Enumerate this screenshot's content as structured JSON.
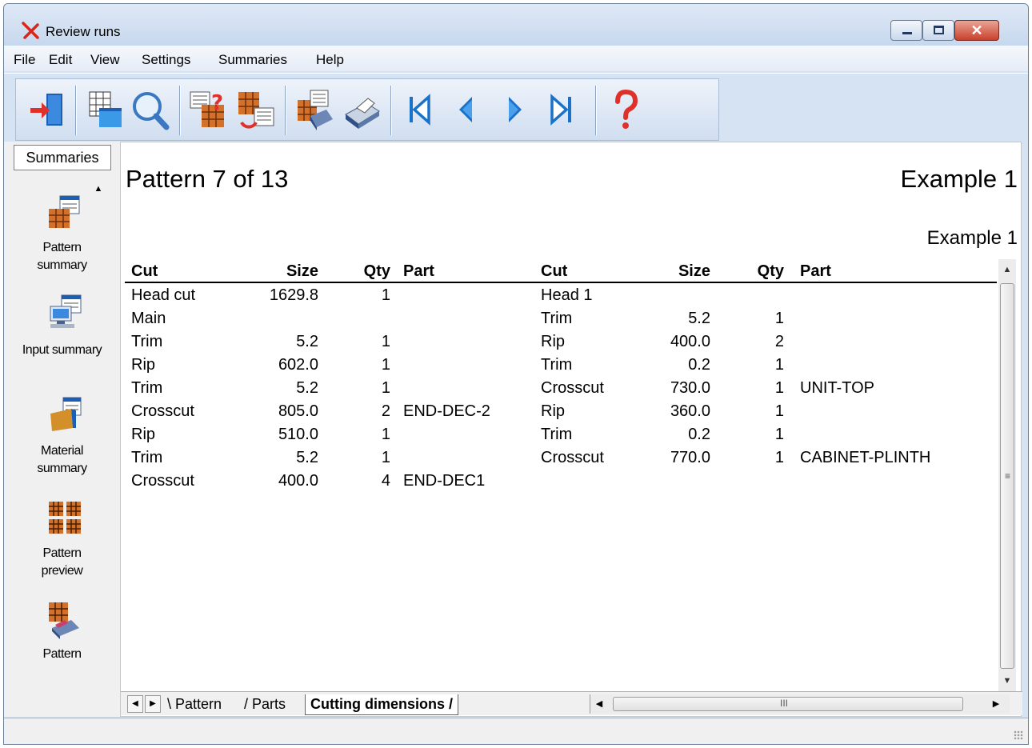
{
  "window": {
    "title": "Review runs"
  },
  "menu": [
    "File",
    "Edit",
    "View",
    "Settings",
    "Summaries",
    "Help"
  ],
  "toolbar": {
    "icons": [
      "exit-icon",
      "layout-icon",
      "zoom-icon",
      "pattern-help-icon",
      "pattern-refresh-icon",
      "print-preview-icon",
      "print-icon",
      "first-icon",
      "previous-icon",
      "next-icon",
      "last-icon",
      "help-icon"
    ]
  },
  "sidebar": {
    "header": "Summaries",
    "items": [
      {
        "line1": "Pattern",
        "line2": "summary",
        "icon": "pattern-summary-icon"
      },
      {
        "line1": "Input summary",
        "line2": "",
        "icon": "input-summary-icon"
      },
      {
        "line1": "Material",
        "line2": "summary",
        "icon": "material-summary-icon"
      },
      {
        "line1": "Pattern",
        "line2": "preview",
        "icon": "pattern-preview-icon"
      },
      {
        "line1": "Pattern",
        "line2": "",
        "icon": "pattern-icon"
      }
    ]
  },
  "main": {
    "pattern_title": "Pattern 7 of 13",
    "example_title": "Example 1",
    "example_subtitle": "Example 1",
    "headers": [
      "Cut",
      "Size",
      "Qty",
      "Part",
      "Cut",
      "Size",
      "Qty",
      "Part"
    ],
    "left_rows": [
      {
        "cut": "Head cut",
        "size": "1629.8",
        "qty": "1",
        "part": ""
      },
      {
        "cut": "Main",
        "size": "",
        "qty": "",
        "part": ""
      },
      {
        "cut": "Trim",
        "size": "5.2",
        "qty": "1",
        "part": ""
      },
      {
        "cut": "Rip",
        "size": "602.0",
        "qty": "1",
        "part": ""
      },
      {
        "cut": "Trim",
        "size": "5.2",
        "qty": "1",
        "part": ""
      },
      {
        "cut": "Crosscut",
        "size": "805.0",
        "qty": "2",
        "part": "END-DEC-2"
      },
      {
        "cut": "Rip",
        "size": "510.0",
        "qty": "1",
        "part": ""
      },
      {
        "cut": "Trim",
        "size": "5.2",
        "qty": "1",
        "part": ""
      },
      {
        "cut": "Crosscut",
        "size": "400.0",
        "qty": "4",
        "part": "END-DEC1"
      }
    ],
    "right_rows": [
      {
        "cut": "Head  1",
        "size": "",
        "qty": "",
        "part": ""
      },
      {
        "cut": "Trim",
        "size": "5.2",
        "qty": "1",
        "part": ""
      },
      {
        "cut": "Rip",
        "size": "400.0",
        "qty": "2",
        "part": ""
      },
      {
        "cut": "Trim",
        "size": "0.2",
        "qty": "1",
        "part": ""
      },
      {
        "cut": "Crosscut",
        "size": "730.0",
        "qty": "1",
        "part": "UNIT-TOP"
      },
      {
        "cut": "Rip",
        "size": "360.0",
        "qty": "1",
        "part": ""
      },
      {
        "cut": "Trim",
        "size": "0.2",
        "qty": "1",
        "part": ""
      },
      {
        "cut": "Crosscut",
        "size": "770.0",
        "qty": "1",
        "part": "CABINET-PLINTH"
      }
    ]
  },
  "tabs": {
    "items": [
      "Pattern",
      "Parts",
      "Cutting dimensions"
    ],
    "active": "Cutting dimensions"
  },
  "colors": {
    "titlebar": "#c6d8ee",
    "close_button": "#c9402b",
    "icon_blue": "#1a5fb4",
    "help_red": "#e0302a"
  }
}
